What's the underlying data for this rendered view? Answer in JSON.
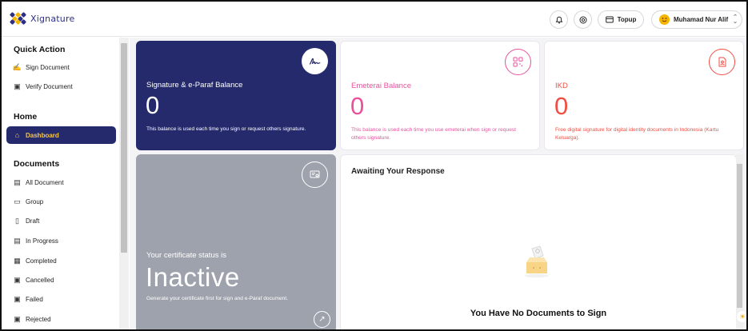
{
  "brand": {
    "name": "Xignature"
  },
  "topbar": {
    "topup_label": "Topup",
    "user_name": "Muhamad Nur Alif"
  },
  "sidebar": {
    "quick_action": {
      "title": "Quick Action",
      "items": [
        {
          "label": "Sign Document",
          "icon": "sign-icon"
        },
        {
          "label": "Verify Document",
          "icon": "verify-icon"
        }
      ]
    },
    "home": {
      "title": "Home",
      "items": [
        {
          "label": "Dashboard",
          "icon": "home-icon",
          "active": true
        }
      ]
    },
    "documents": {
      "title": "Documents",
      "items": [
        {
          "label": "All Document",
          "icon": "document-icon"
        },
        {
          "label": "Group",
          "icon": "folder-icon"
        },
        {
          "label": "Draft",
          "icon": "draft-icon"
        },
        {
          "label": "In Progress",
          "icon": "progress-icon"
        },
        {
          "label": "Completed",
          "icon": "completed-icon"
        },
        {
          "label": "Cancelled",
          "icon": "cancelled-icon"
        },
        {
          "label": "Failed",
          "icon": "failed-icon"
        },
        {
          "label": "Rejected",
          "icon": "rejected-icon"
        }
      ]
    }
  },
  "cards": {
    "signature": {
      "title": "Signature & e-Paraf Balance",
      "value": "0",
      "description": "This balance is used each time you sign or request others signature."
    },
    "emeterai": {
      "title": "Emeterai Balance",
      "value": "0",
      "description": "This balance is used each time you use emeterai when sign or request others signature."
    },
    "ikd": {
      "title": "IKD",
      "value": "0",
      "description": "Free digital signature for digital identity documents in Indonesia (Kartu Keluarga)."
    },
    "certificate": {
      "label": "Your certificate status is",
      "status": "Inactive",
      "description": "Generate your certificate first for sign and e-Paraf document."
    },
    "awaiting": {
      "title": "Awaiting Your Response",
      "empty_title": "You Have No Documents to Sign"
    }
  },
  "colors": {
    "primary": "#252a6d",
    "accent": "#f5c64a",
    "emeterai": "#e8529d",
    "ikd": "#f04e43",
    "certificate_bg": "#9ea2ad"
  }
}
